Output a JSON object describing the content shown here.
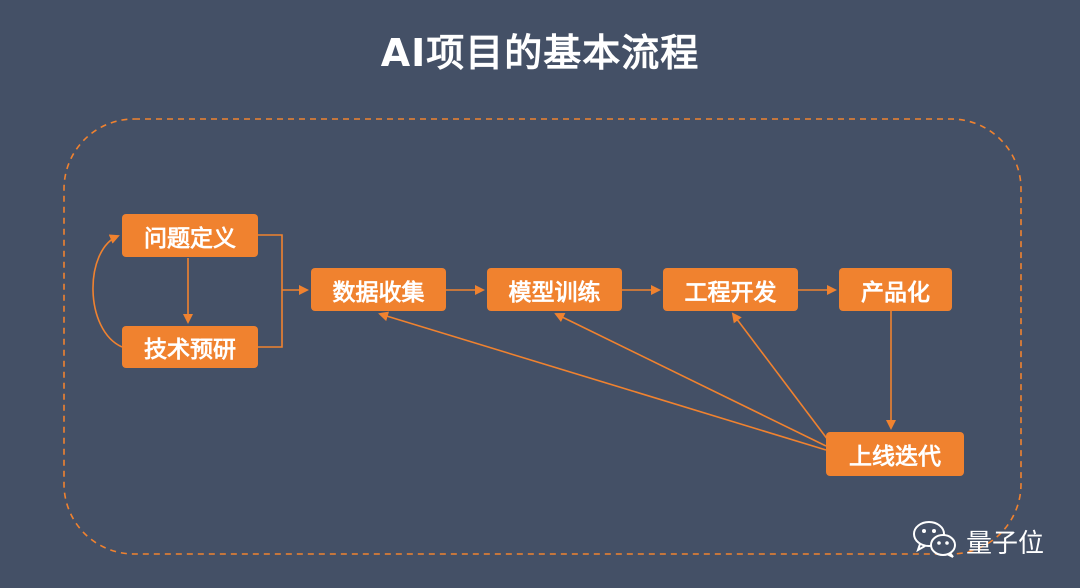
{
  "title": "AI项目的基本流程",
  "nodes": {
    "problem_definition": "问题定义",
    "tech_research": "技术预研",
    "data_collection": "数据收集",
    "model_training": "模型训练",
    "engineering_dev": "工程开发",
    "productization": "产品化",
    "launch_iteration": "上线迭代"
  },
  "watermark": {
    "text": "量子位",
    "icon": "wechat-icon"
  },
  "colors": {
    "background": "#445066",
    "node_fill": "#F0822F",
    "arrow": "#F0822F",
    "dashed_border": "#F0822F",
    "text": "#ffffff"
  }
}
